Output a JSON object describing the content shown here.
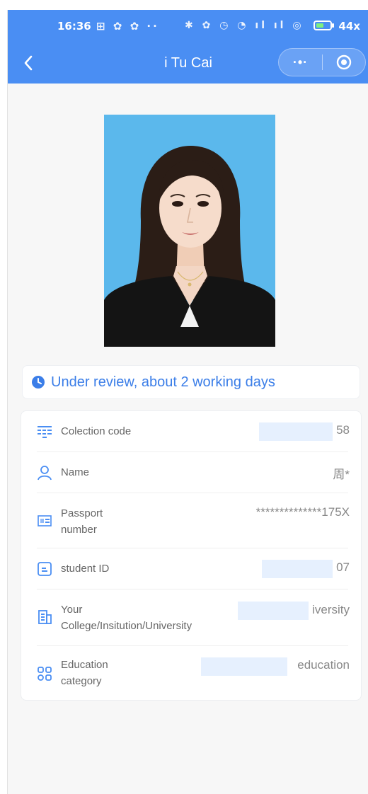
{
  "status_bar": {
    "time": "16:36",
    "left_icons": "⊞ ✿ ✿ ··",
    "right_icons": "✱ ✿ ◷ ◔ ıl ıl ◎",
    "battery": "44"
  },
  "nav": {
    "title": "i Tu Cai",
    "more_glyph": "·•·"
  },
  "status_message": "Under review, about 2 working days",
  "fields": [
    {
      "label": "Colection code",
      "value": "58",
      "icon": "barcode-icon"
    },
    {
      "label": "Name",
      "value": "周*",
      "icon": "person-icon"
    },
    {
      "label": "Passport\nnumber",
      "value": "**************175X",
      "icon": "passport-icon"
    },
    {
      "label": "student ID",
      "value": "07",
      "icon": "student-id-icon"
    },
    {
      "label": "Your\nCollege/Insitution/University",
      "value": "iversity",
      "icon": "building-icon"
    },
    {
      "label": "Education\ncategory",
      "value": "education",
      "icon": "grid-icon"
    }
  ],
  "colors": {
    "accent": "#4a8ef3",
    "status_text": "#3b7ee8",
    "photo_bg": "#5bb8ec",
    "mask": "#e6f0fe"
  }
}
